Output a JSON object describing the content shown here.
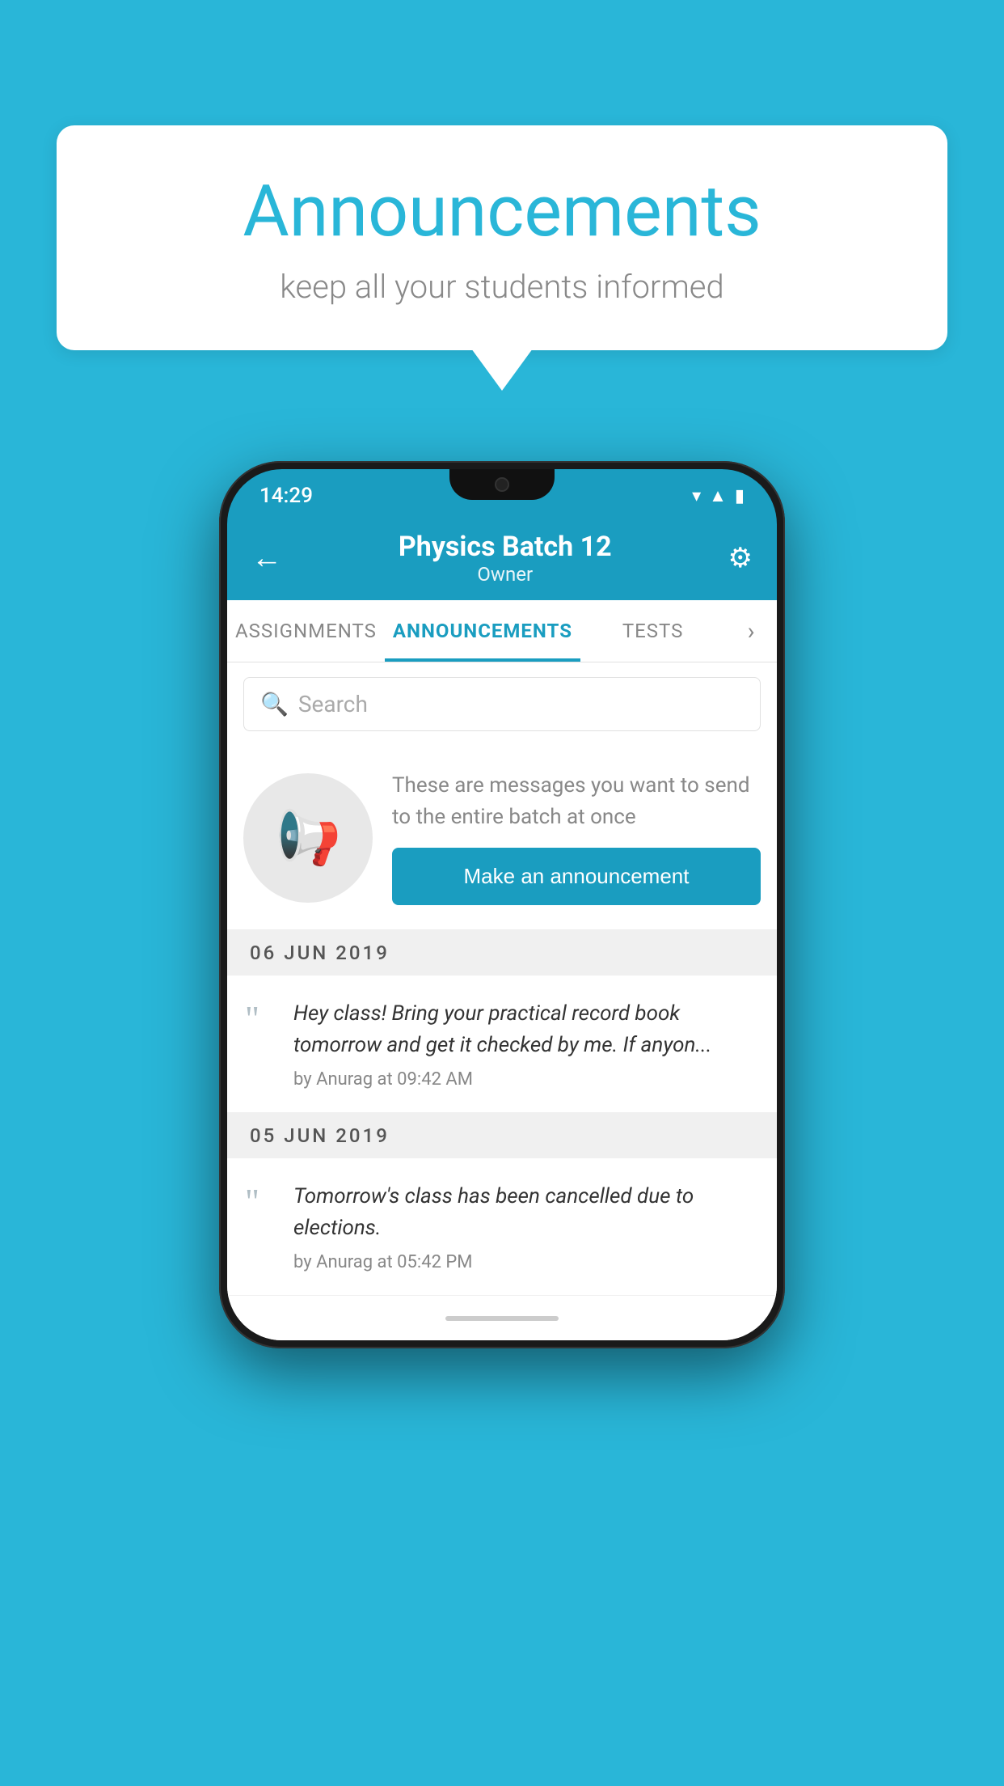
{
  "page": {
    "background_color": "#29b6d8"
  },
  "speech_bubble": {
    "title": "Announcements",
    "subtitle": "keep all your students informed"
  },
  "phone": {
    "status_bar": {
      "time": "14:29"
    },
    "header": {
      "back_label": "←",
      "title": "Physics Batch 12",
      "subtitle": "Owner",
      "settings_label": "⚙"
    },
    "tabs": [
      {
        "label": "ASSIGNMENTS",
        "active": false
      },
      {
        "label": "ANNOUNCEMENTS",
        "active": true
      },
      {
        "label": "TESTS",
        "active": false
      }
    ],
    "tab_more": "›",
    "search": {
      "placeholder": "Search"
    },
    "empty_state": {
      "description": "These are messages you want to send to the entire batch at once",
      "button_label": "Make an announcement"
    },
    "announcements": [
      {
        "date": "06  JUN  2019",
        "text": "Hey class! Bring your practical record book tomorrow and get it checked by me. If anyon...",
        "author": "by Anurag at 09:42 AM"
      },
      {
        "date": "05  JUN  2019",
        "text": "Tomorrow's class has been cancelled due to elections.",
        "author": "by Anurag at 05:42 PM"
      }
    ]
  }
}
